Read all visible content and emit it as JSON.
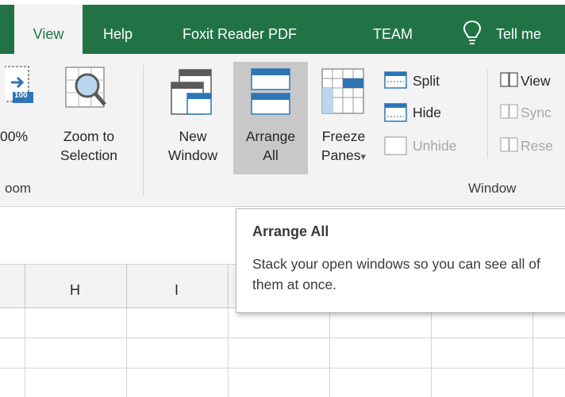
{
  "tabs": [
    {
      "label": "View",
      "active": true
    },
    {
      "label": "Help"
    },
    {
      "label": "Foxit Reader PDF"
    },
    {
      "label": "TEAM"
    },
    {
      "label": "Tell me"
    }
  ],
  "ribbon": {
    "zoom_group": {
      "label": "oom",
      "zoom100_label": "00%",
      "zoom100_badge": "100",
      "zoom_to_selection": [
        "Zoom to",
        "Selection"
      ]
    },
    "window_group": {
      "label": "Window",
      "new_window": [
        "New",
        "Window"
      ],
      "arrange_all": [
        "Arrange",
        "All"
      ],
      "freeze_panes": [
        "Freeze",
        "Panes"
      ],
      "freeze_dropdown": "▾",
      "split": "Split",
      "hide": "Hide",
      "unhide": "Unhide",
      "view_side": "View",
      "sync_scroll": "Sync",
      "reset_position": "Rese"
    }
  },
  "columns": [
    "H",
    "I"
  ],
  "tooltip": {
    "title": "Arrange All",
    "description": "Stack your open windows so you can see all of them at once."
  },
  "colors": {
    "accent": "#217346",
    "ribbon_bg": "#f3f3f3",
    "highlight": "#c8c8c8",
    "icon_blue": "#2e75b6"
  }
}
